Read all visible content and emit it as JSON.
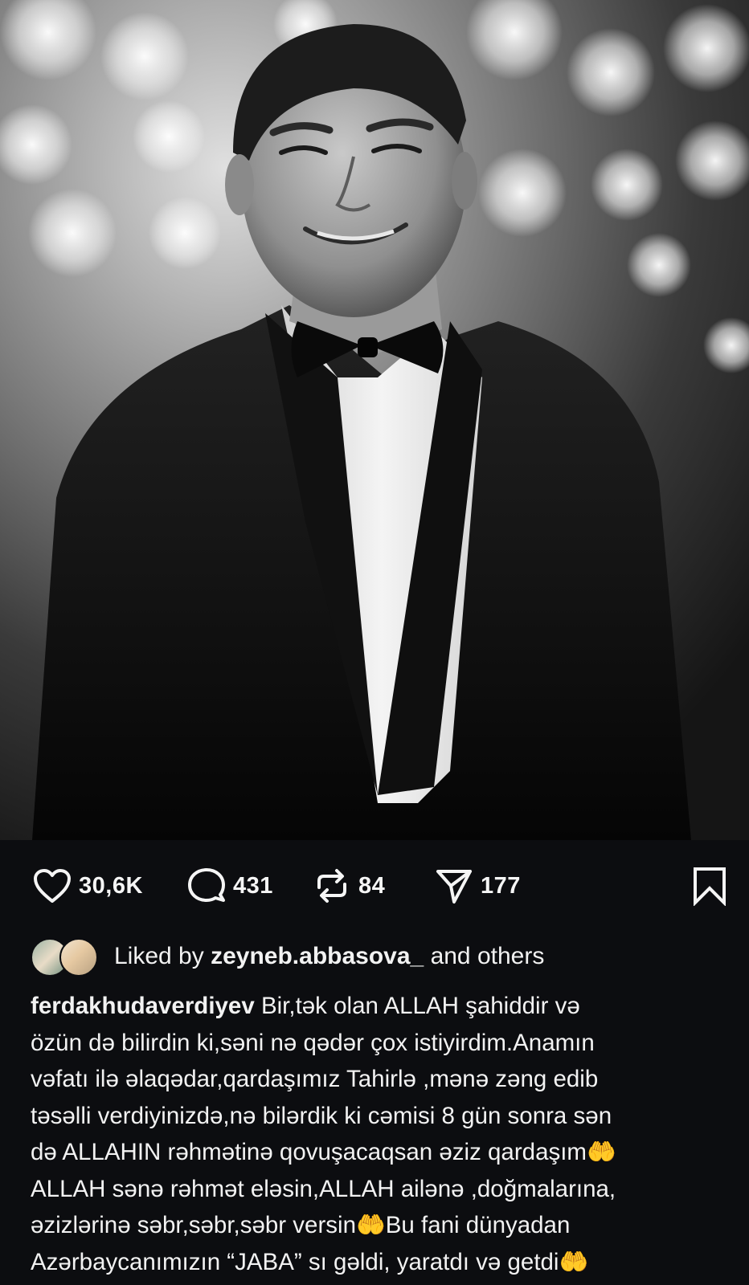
{
  "post": {
    "photo_alt": "black-and-white portrait photo",
    "likes_count": "30,6K",
    "comments_count": "431",
    "reposts_count": "84",
    "shares_count": "177"
  },
  "liked_by": {
    "prefix": "Liked by",
    "user": "zeyneb.abbasova_",
    "suffix": "and others"
  },
  "caption": {
    "username": "ferdakhudaverdiyev",
    "lines": [
      " Bir,tək olan ALLAH şahiddir və",
      "özün də bilirdin ki,səni nə qədər çox istiyirdim.Anamın",
      "vəfatı ilə əlaqədar,qardaşımız Tahirlə ,mənə zəng edib",
      "təsəlli verdiyinizdə,nə bilərdik ki cəmisi 8 gün sonra sən",
      "də ALLAHIN rəhmətinə qovuşacaqsan əziz qardaşım🤲",
      "ALLAH  sənə rəhmət eləsin,ALLAH ailənə ,doğmalarına,",
      "əzizlərinə səbr,səbr,səbr versin🤲Bu fani dünyadan",
      "Azərbaycanımızın “JABA” sı gəldi, yaratdı və getdi🤲"
    ]
  },
  "icons": {
    "like": "heart-icon",
    "comment": "comment-bubble-icon",
    "repost": "repost-icon",
    "share": "send-icon",
    "save": "bookmark-icon"
  },
  "colors": {
    "background": "#0c0d10",
    "text": "#f5f5f5"
  }
}
